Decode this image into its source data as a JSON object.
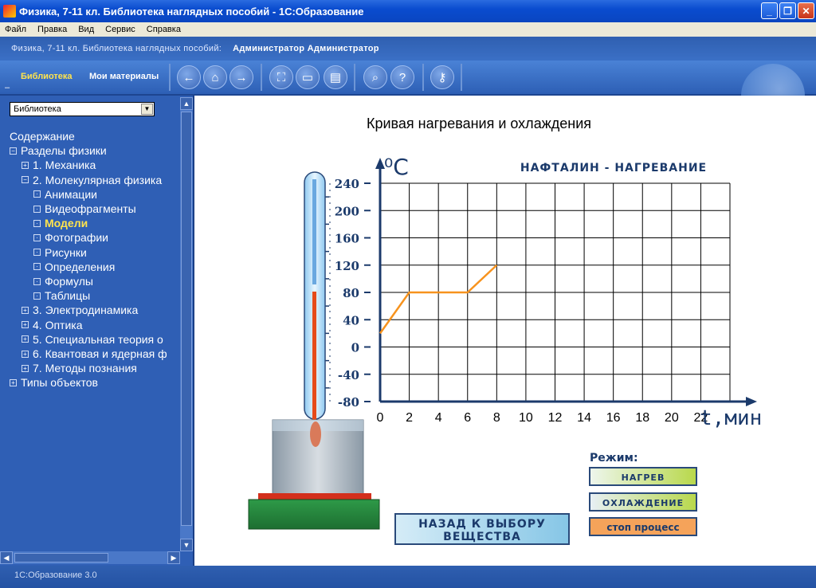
{
  "window": {
    "title": "Физика, 7-11 кл. Библиотека наглядных пособий - 1С:Образование",
    "minimize": "_",
    "restore": "❐",
    "close": "✕"
  },
  "menu": [
    "Файл",
    "Правка",
    "Вид",
    "Сервис",
    "Справка"
  ],
  "header": {
    "app": "Физика, 7-11 кл. Библиотека наглядных пособий:",
    "user": "Администратор Администратор"
  },
  "toolbar": {
    "tab_library": "Библиотека",
    "tab_materials": "Мои материалы",
    "collapse": "–"
  },
  "sidebar": {
    "select_value": "Библиотека",
    "tree": [
      {
        "label": "Содержание",
        "level": 0,
        "box": ""
      },
      {
        "label": "Разделы физики",
        "level": 0,
        "box": "−"
      },
      {
        "label": "1. Механика",
        "level": 1,
        "box": "+"
      },
      {
        "label": "2. Молекулярная физика",
        "level": 1,
        "box": "−"
      },
      {
        "label": "Анимации",
        "level": 2,
        "box": "·"
      },
      {
        "label": "Видеофрагменты",
        "level": 2,
        "box": "·"
      },
      {
        "label": "Модели",
        "level": 2,
        "box": "·",
        "active": true
      },
      {
        "label": "Фотографии",
        "level": 2,
        "box": "·"
      },
      {
        "label": "Рисунки",
        "level": 2,
        "box": "·"
      },
      {
        "label": "Определения",
        "level": 2,
        "box": "·"
      },
      {
        "label": "Формулы",
        "level": 2,
        "box": "·"
      },
      {
        "label": "Таблицы",
        "level": 2,
        "box": "·"
      },
      {
        "label": "3. Электродинамика",
        "level": 1,
        "box": "+"
      },
      {
        "label": "4. Оптика",
        "level": 1,
        "box": "+"
      },
      {
        "label": "5. Специальная теория о",
        "level": 1,
        "box": "+"
      },
      {
        "label": "6. Квантовая и ядерная ф",
        "level": 1,
        "box": "+"
      },
      {
        "label": "7. Методы познания",
        "level": 1,
        "box": "+"
      },
      {
        "label": "Типы объектов",
        "level": 0,
        "box": "+"
      }
    ]
  },
  "model": {
    "title": "Кривая нагревания и охлаждения",
    "substance_title": "НАФТАЛИН - НАГРЕВАНИЕ",
    "y_unit": "⁰C",
    "x_unit": "t,мин",
    "y_ticks": [
      "240",
      "200",
      "160",
      "120",
      "80",
      "40",
      "0",
      "-40",
      "-80"
    ],
    "x_ticks": [
      "0",
      "2",
      "4",
      "6",
      "8",
      "10",
      "12",
      "14",
      "16",
      "18",
      "20",
      "22"
    ],
    "mode_label": "Режим:",
    "btn_heat": "НАГРЕВ",
    "btn_cool": "ОХЛАЖДЕНИЕ",
    "btn_stop": "стоп процесс",
    "btn_back_line1": "НАЗАД К ВЫБОРУ",
    "btn_back_line2": "ВЕЩЕСТВА",
    "thermometer_reading": 80,
    "colors": {
      "curve": "#f7931e",
      "grid": "#000000",
      "scale_text": "#1b3a6b",
      "mercury": "#e64a19"
    }
  },
  "chart_data": {
    "type": "line",
    "title": "НАФТАЛИН - НАГРЕВАНИЕ",
    "xlabel": "t,мин",
    "ylabel": "⁰C",
    "xlim": [
      0,
      24
    ],
    "ylim": [
      -80,
      240
    ],
    "grid": true,
    "series": [
      {
        "x": [
          0,
          2,
          4,
          6,
          8
        ],
        "y": [
          20,
          80,
          80,
          80,
          120
        ]
      }
    ]
  },
  "status": {
    "text": "1С:Образование 3.0"
  }
}
